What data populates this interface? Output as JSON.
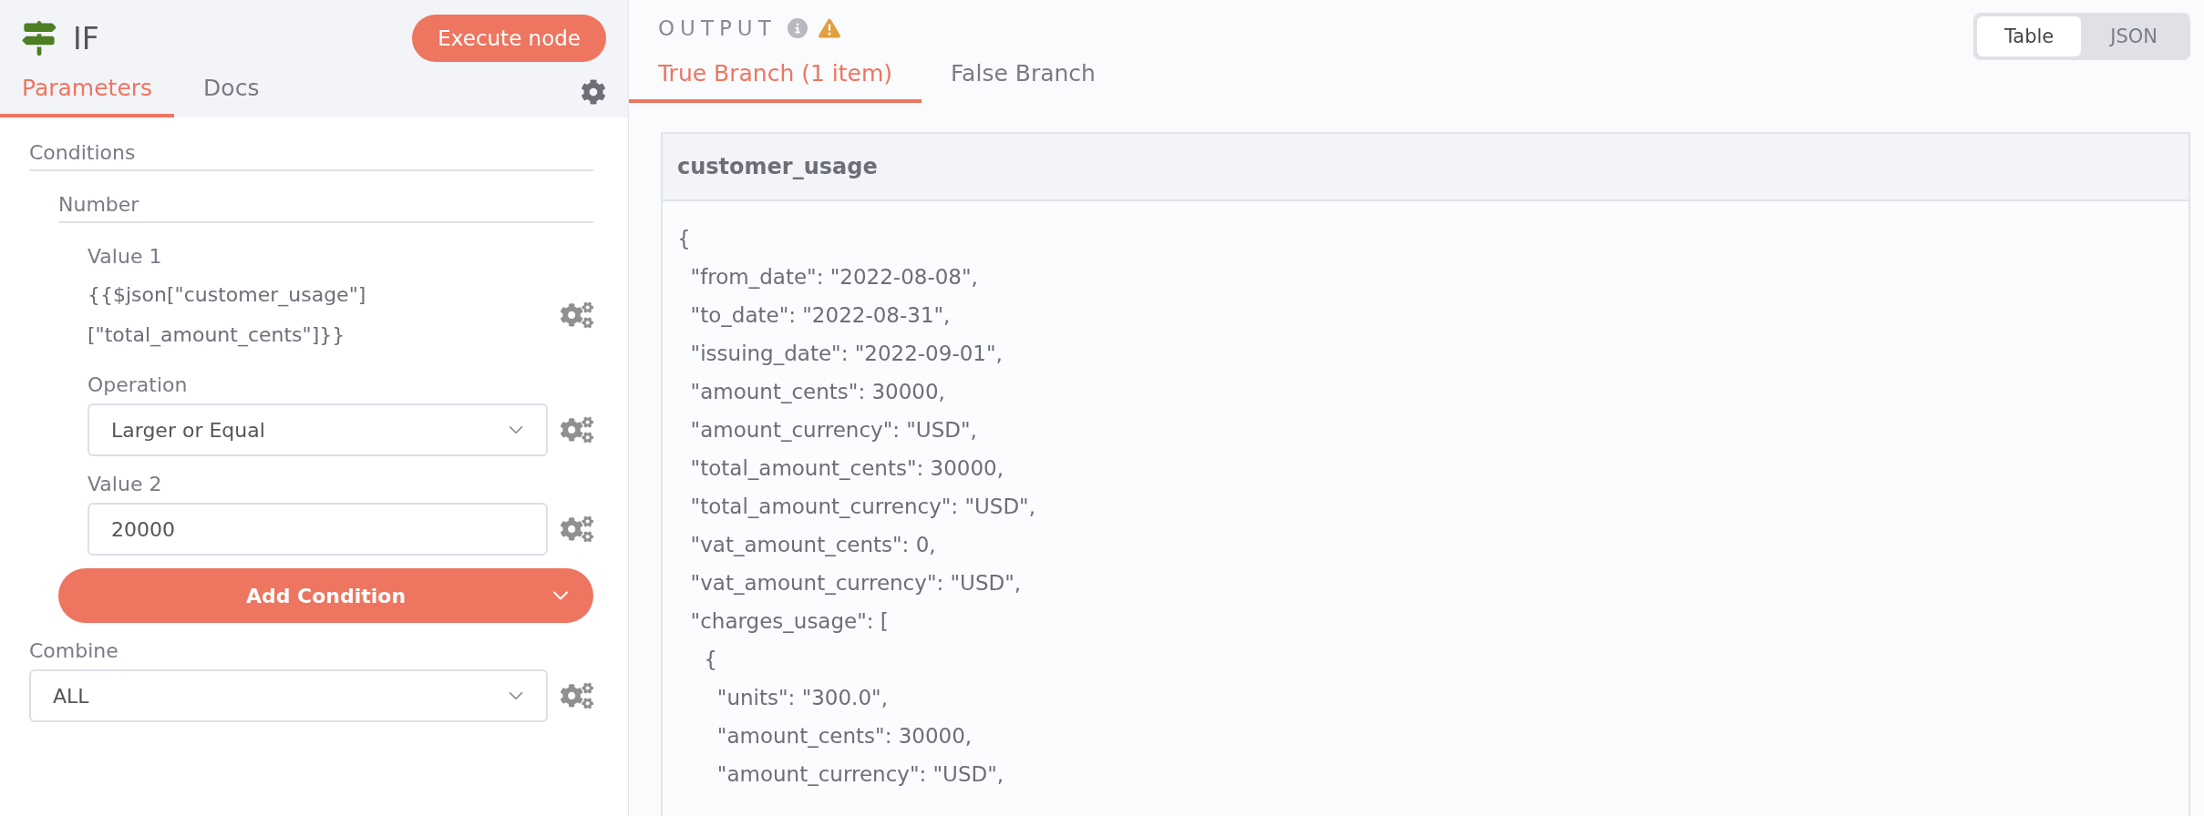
{
  "node": {
    "title": "IF",
    "execute_button": "Execute node"
  },
  "tabs": [
    {
      "label": "Parameters",
      "selected": true
    },
    {
      "label": "Docs",
      "selected": false
    }
  ],
  "parameters": {
    "section": "Conditions",
    "group": "Number",
    "value_1": {
      "label": "Value 1",
      "expression": "{{$json[\"customer_usage\"][\"total_amount_cents\"]}}"
    },
    "operation": {
      "label": "Operation",
      "value": "Larger or Equal"
    },
    "value_2": {
      "label": "Value 2",
      "value": "20000"
    },
    "add_condition": "Add Condition",
    "combine": {
      "label": "Combine",
      "value": "ALL"
    }
  },
  "output": {
    "title": "OUTPUT",
    "views": [
      {
        "label": "Table",
        "selected": true
      },
      {
        "label": "JSON",
        "selected": false
      }
    ],
    "branches": [
      {
        "label": "True Branch (1 item)",
        "selected": true
      },
      {
        "label": "False Branch",
        "selected": false
      }
    ],
    "table": {
      "columns": [
        "customer_usage"
      ],
      "lines": [
        "{",
        "  \"from_date\": \"2022-08-08\",",
        "  \"to_date\": \"2022-08-31\",",
        "  \"issuing_date\": \"2022-09-01\",",
        "  \"amount_cents\": 30000,",
        "  \"amount_currency\": \"USD\",",
        "  \"total_amount_cents\": 30000,",
        "  \"total_amount_currency\": \"USD\",",
        "  \"vat_amount_cents\": 0,",
        "  \"vat_amount_currency\": \"USD\",",
        "  \"charges_usage\": [",
        "    {",
        "      \"units\": \"300.0\",",
        "      \"amount_cents\": 30000,",
        "      \"amount_currency\": \"USD\","
      ]
    }
  }
}
